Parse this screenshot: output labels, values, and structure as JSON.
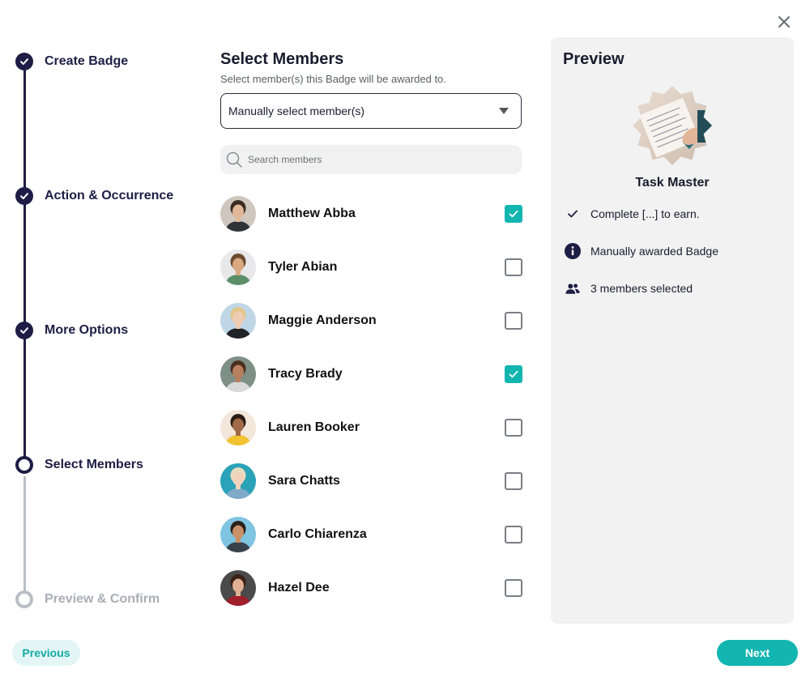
{
  "stepper": {
    "steps": [
      {
        "label": "Create Badge",
        "state": "done"
      },
      {
        "label": "Action & Occurrence",
        "state": "done"
      },
      {
        "label": "More Options",
        "state": "done"
      },
      {
        "label": "Select Members",
        "state": "current"
      },
      {
        "label": "Preview & Confirm",
        "state": "pending"
      }
    ]
  },
  "members_section": {
    "title": "Select Members",
    "subtitle": "Select member(s) this Badge will be awarded to.",
    "select_value": "Manually select member(s)",
    "search_placeholder": "Search members"
  },
  "members": [
    {
      "name": "Matthew Abba",
      "checked": true,
      "avatar_bg": "#cfc6bd",
      "hair": "#3b2b22",
      "skin": "#e2b898",
      "shirt": "#2f3338"
    },
    {
      "name": "Tyler Abian",
      "checked": false,
      "avatar_bg": "#e8e8ea",
      "hair": "#6b4a2e",
      "skin": "#d9a982",
      "shirt": "#5a8f6a"
    },
    {
      "name": "Maggie Anderson",
      "checked": false,
      "avatar_bg": "#bfd6e6",
      "hair": "#e2c58c",
      "skin": "#f0cdb2",
      "shirt": "#1f2428"
    },
    {
      "name": "Tracy Brady",
      "checked": true,
      "avatar_bg": "#7e8f86",
      "hair": "#4a2f1f",
      "skin": "#b98060",
      "shirt": "#d9d9d9"
    },
    {
      "name": "Lauren Booker",
      "checked": false,
      "avatar_bg": "#f3e6da",
      "hair": "#2a1c15",
      "skin": "#a06a48",
      "shirt": "#f2c230"
    },
    {
      "name": "Sara Chatts",
      "checked": false,
      "avatar_bg": "#2aa2b8",
      "hair": "#e8dcc0",
      "skin": "#f1d3bc",
      "shirt": "#7fa9c9"
    },
    {
      "name": "Carlo Chiarenza",
      "checked": false,
      "avatar_bg": "#7fc4e0",
      "hair": "#2b2018",
      "skin": "#c9916a",
      "shirt": "#39414a"
    },
    {
      "name": "Hazel Dee",
      "checked": false,
      "avatar_bg": "#4a4a4a",
      "hair": "#3b1f14",
      "skin": "#e0b094",
      "shirt": "#a01f2a"
    },
    {
      "name": "",
      "checked": false,
      "avatar_bg": "#9fc7d6",
      "hair": "#2b2018",
      "skin": "#c9916a",
      "shirt": "#39414a"
    }
  ],
  "preview": {
    "title": "Preview",
    "badge_name": "Task Master",
    "criteria": "Complete [...] to earn.",
    "award_type": "Manually awarded Badge",
    "selected_count": "3 members selected"
  },
  "footer": {
    "previous_label": "Previous",
    "next_label": "Next"
  },
  "colors": {
    "accent": "#12b5b0",
    "navy": "#1d1d45",
    "pending": "#b9bec6"
  },
  "icons": [
    "close-icon",
    "check-icon",
    "chevron-down-icon",
    "search-icon",
    "info-icon",
    "users-icon"
  ]
}
